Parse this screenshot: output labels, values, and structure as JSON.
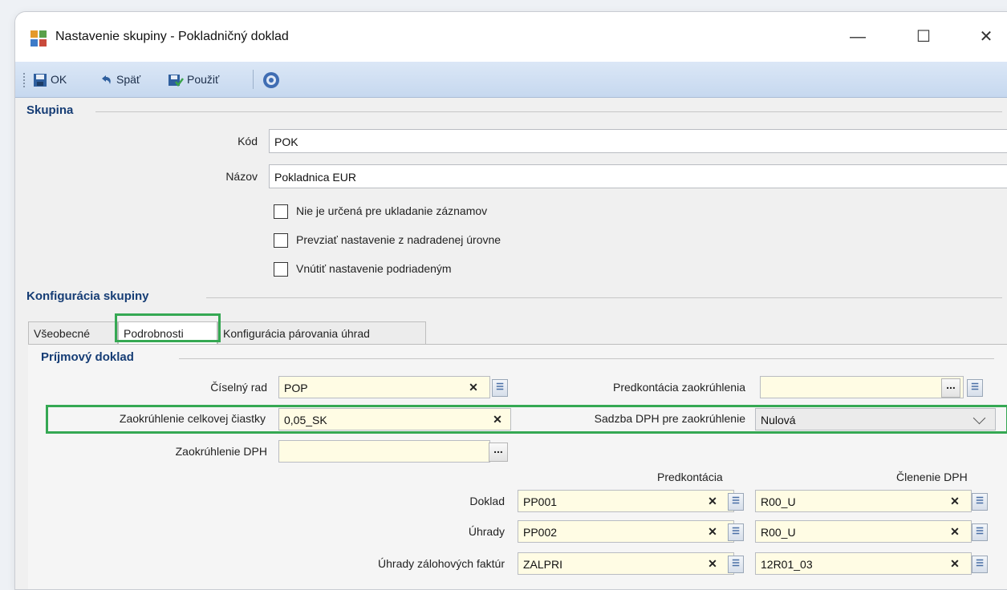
{
  "window": {
    "title": "Nastavenie skupiny - Pokladničný doklad",
    "icon": "app-puzzle-icon",
    "controls": {
      "minimize": "—",
      "maximize": "☐",
      "close": "✕"
    }
  },
  "toolbar": {
    "ok_label": "OK",
    "back_label": "Späť",
    "apply_label": "Použiť",
    "help_icon": "help-icon"
  },
  "group": {
    "section_title": "Skupina",
    "code_label": "Kód",
    "code_value": "POK",
    "name_label": "Názov",
    "name_value": "Pokladnica EUR",
    "checkboxes": [
      {
        "label": "Nie je určená pre ukladanie záznamov",
        "checked": false
      },
      {
        "label": "Prevziať nastavenie z nadradenej úrovne",
        "checked": false
      },
      {
        "label": "Vnútiť nastavenie podriadeným",
        "checked": false
      }
    ]
  },
  "config": {
    "section_title": "Konfigurácia skupiny",
    "tabs": [
      {
        "label": "Všeobecné",
        "active": false
      },
      {
        "label": "Podrobnosti",
        "active": true
      },
      {
        "label": "Konfigurácia párovania úhrad",
        "active": false
      }
    ]
  },
  "income": {
    "section_title": "Príjmový doklad",
    "series_label": "Číselný rad",
    "series_value": "POP",
    "rounding_posting_label": "Predkontácia zaokrúhlenia",
    "rounding_posting_value": "",
    "total_rounding_label": "Zaokrúhlenie celkovej čiastky",
    "total_rounding_value": "0,05_SK",
    "vat_rate_label": "Sadzba DPH pre zaokrúhlenie",
    "vat_rate_value": "Nulová",
    "vat_rounding_label": "Zaokrúhlenie DPH",
    "vat_rounding_value": "",
    "col_posting": "Predkontácia",
    "col_vat_split": "Členenie DPH",
    "rows": [
      {
        "label": "Doklad",
        "posting": "PP001",
        "vat": "R00_U"
      },
      {
        "label": "Úhrady",
        "posting": "PP002",
        "vat": "R00_U"
      },
      {
        "label": "Úhrady zálohových faktúr",
        "posting": "ZALPRI",
        "vat": "12R01_03"
      }
    ]
  },
  "colors": {
    "highlight": "#35a853",
    "section": "#163d75",
    "toolbar": "#c6d8ef",
    "field_yellow": "#fffce4"
  }
}
